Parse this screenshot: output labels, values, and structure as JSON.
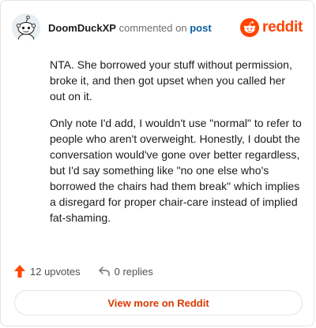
{
  "header": {
    "username": "DoomDuckXP",
    "action_text": "commented on",
    "target_link": "post",
    "brand_wordmark": "reddit"
  },
  "icons": {
    "avatar": "snoo-avatar",
    "brand": "reddit-logo-icon",
    "upvote": "upvote-arrow-icon",
    "reply": "reply-arrow-icon"
  },
  "comment": {
    "paragraphs": [
      "NTA. She borrowed your stuff without permission, broke it, and then got upset when you called her out on it.",
      "Only note I'd add, I wouldn't use \"normal\" to refer to people who aren't overweight. Honestly, I doubt the conversation would've gone over better regardless, but I'd say something like \"no one else who's borrowed the chairs had them break\" which implies a disregard for proper chair-care instead of implied fat-shaming."
    ]
  },
  "actions": {
    "upvotes_label": "12 upvotes",
    "replies_label": "0 replies"
  },
  "footer": {
    "view_more_label": "View more on Reddit"
  },
  "colors": {
    "accent": "#ff4500",
    "link": "#0b5fa5",
    "view_more": "#d93a00"
  }
}
